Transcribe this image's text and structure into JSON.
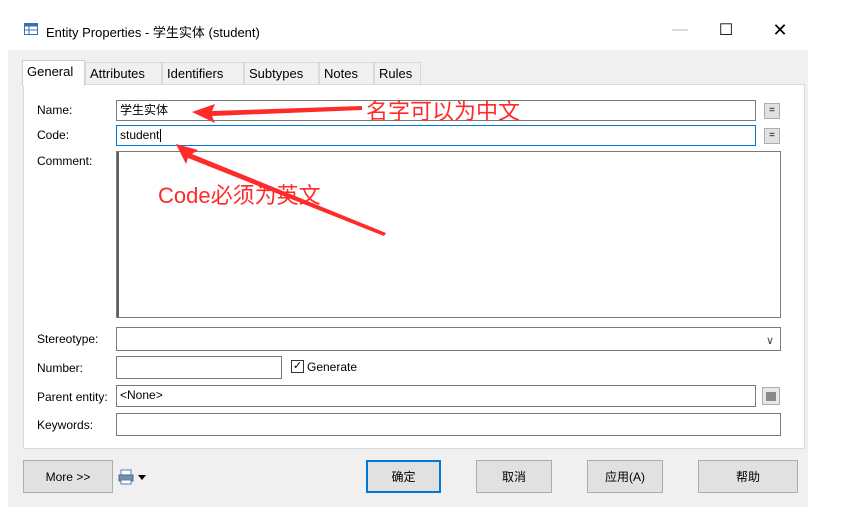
{
  "window": {
    "title": "Entity Properties - 学生实体 (student)",
    "minimize_glyph": "—",
    "maximize_glyph": "☐",
    "close_glyph": "✕"
  },
  "tabs": [
    {
      "label": "General",
      "active": true
    },
    {
      "label": "Attributes"
    },
    {
      "label": "Identifiers"
    },
    {
      "label": "Subtypes"
    },
    {
      "label": "Notes"
    },
    {
      "label": "Rules"
    }
  ],
  "form": {
    "name_label": "Name:",
    "name_value": "学生实体",
    "code_label": "Code:",
    "code_value": "student",
    "comment_label": "Comment:",
    "comment_value": "",
    "stereotype_label": "Stereotype:",
    "stereotype_value": "",
    "number_label": "Number:",
    "number_value": "",
    "generate_label": "Generate",
    "generate_checked": true,
    "parent_entity_label": "Parent entity:",
    "parent_entity_value": "<None>",
    "keywords_label": "Keywords:",
    "keywords_value": "",
    "equals_glyph": "="
  },
  "annotations": {
    "name_note": "名字可以为中文",
    "code_note": "Code必须为英文",
    "color": "#ff2a2a"
  },
  "buttons": {
    "more": "More >>",
    "ok": "确定",
    "cancel": "取消",
    "apply": "应用(A)",
    "help": "帮助"
  },
  "icons": {
    "title_icon": "entity-grid-icon",
    "print_icon": "printer-icon",
    "dropdown_icon": "chevron-down-icon",
    "browse_icon": "browse-icon"
  },
  "colors": {
    "accent": "#0078d7",
    "dialog_bg": "#f0f0f0",
    "panel_bg": "#ffffff"
  }
}
